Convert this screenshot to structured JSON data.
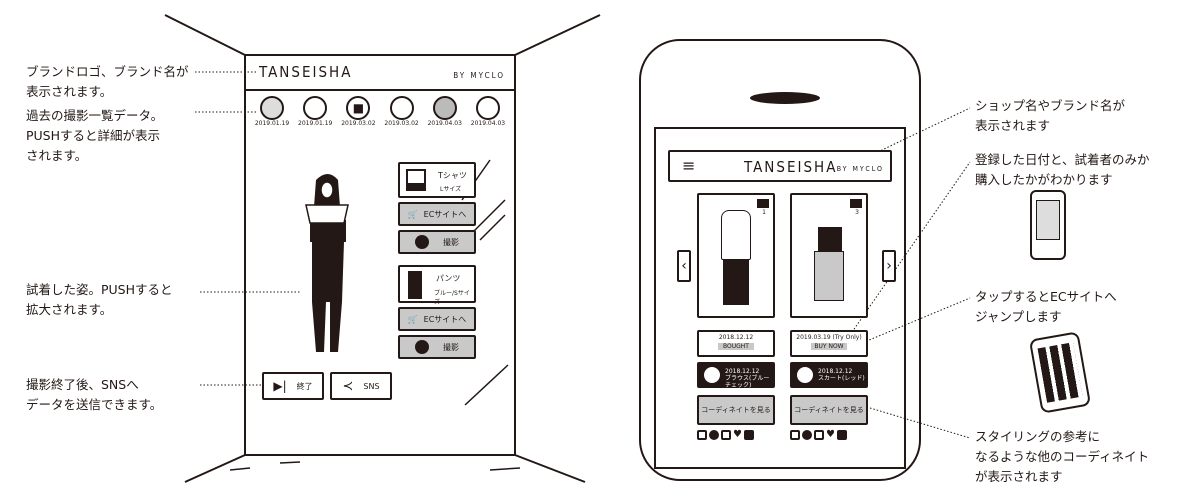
{
  "left_notes": [
    "ブランドロゴ、ブランド名が\n表示されます。",
    "過去の撮影一覧データ。\nPUSHすると詳細が表示\nされます。",
    "試着した姿。PUSHすると\n拡大されます。",
    "撮影終了後、SNSへ\nデータを送信できます。"
  ],
  "right_notes": [
    "ショップ名やブランド名が\n表示されます",
    "登録した日付と、試着者のみか\n購入したかがわかります",
    "タップするとECサイトへ\nジャンプします",
    "スタイリングの参考に\nなるような他のコーディネイト\nが表示されます"
  ],
  "mirror": {
    "brand": "TANSEISHA",
    "by": "BY MYCLO",
    "history": [
      {
        "icon": "jacket-icon",
        "date": "2019.01.19"
      },
      {
        "icon": "shirt-icon",
        "date": "2019.01.19"
      },
      {
        "icon": "tshirt-icon",
        "date": "2019.03.02"
      },
      {
        "icon": "skirt-icon",
        "date": "2019.03.02"
      },
      {
        "icon": "pleated-skirt-icon",
        "date": "2019.04.03"
      },
      {
        "icon": "blouse-icon",
        "date": "2019.04.03"
      }
    ],
    "items": [
      {
        "name": "Tシャツ",
        "size": "Lサイズ",
        "ec": "ECサイトへ",
        "shoot": "撮影"
      },
      {
        "name": "パンツ",
        "size": "ブルー/Sサイズ",
        "ec": "ECサイトへ",
        "shoot": "撮影"
      }
    ],
    "end_label": "終了",
    "sns_label": "SNS"
  },
  "phone": {
    "brand": "TANSEISHA",
    "by": "BY MYCLO",
    "looks": [
      {
        "count": "1",
        "date": "2018.12.12",
        "status": "BOUGHT",
        "item_date": "2018.12.12",
        "item_name": "ブラウス(ブルーチェック)",
        "coord": "コーディネイトを見る"
      },
      {
        "count": "3",
        "date": "2019.03.19 (Try Only)",
        "status": "BUY NOW",
        "item_date": "2018.12.12",
        "item_name": "スカート(レッド)",
        "coord": "コーディネイトを見る"
      }
    ]
  },
  "colors": {
    "ink": "#231815",
    "gray": "#c9c9c9"
  }
}
